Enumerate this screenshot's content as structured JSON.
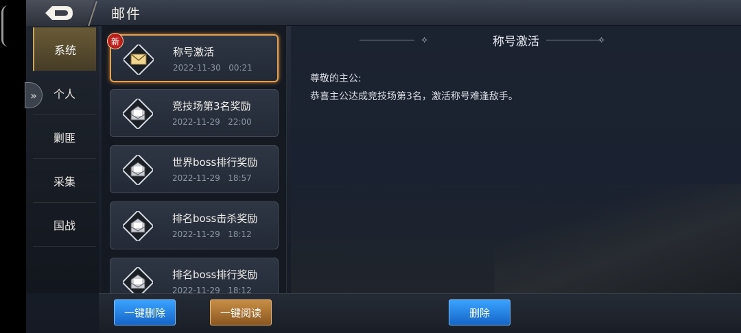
{
  "header": {
    "title": "邮件"
  },
  "sidebar": {
    "tabs": [
      {
        "label": "系统",
        "active": true
      },
      {
        "label": "个人",
        "active": false
      },
      {
        "label": "剿匪",
        "active": false
      },
      {
        "label": "采集",
        "active": false
      },
      {
        "label": "国战",
        "active": false
      }
    ]
  },
  "mail_list": {
    "new_badge": "新",
    "items": [
      {
        "subject": "称号激活",
        "date": "2022-11-30",
        "time": "00:21",
        "icon": "envelope-closed-icon"
      },
      {
        "subject": "竞技场第3名奖励",
        "date": "2022-11-29",
        "time": "22:00",
        "icon": "envelope-open-icon"
      },
      {
        "subject": "世界boss排行奖励",
        "date": "2022-11-29",
        "time": "18:57",
        "icon": "envelope-open-icon"
      },
      {
        "subject": "排名boss击杀奖励",
        "date": "2022-11-29",
        "time": "18:12",
        "icon": "envelope-open-icon"
      },
      {
        "subject": "排名boss排行奖励",
        "date": "2022-11-29",
        "time": "18:12",
        "icon": "envelope-open-icon"
      }
    ]
  },
  "mail_detail": {
    "title": "称号激活",
    "greeting": "尊敬的主公:",
    "body": "恭喜主公达成竞技场第3名，激活称号难逢敌手。"
  },
  "footer": {
    "delete_all_label": "一键删除",
    "read_all_label": "一键阅读",
    "delete_label": "删除"
  }
}
